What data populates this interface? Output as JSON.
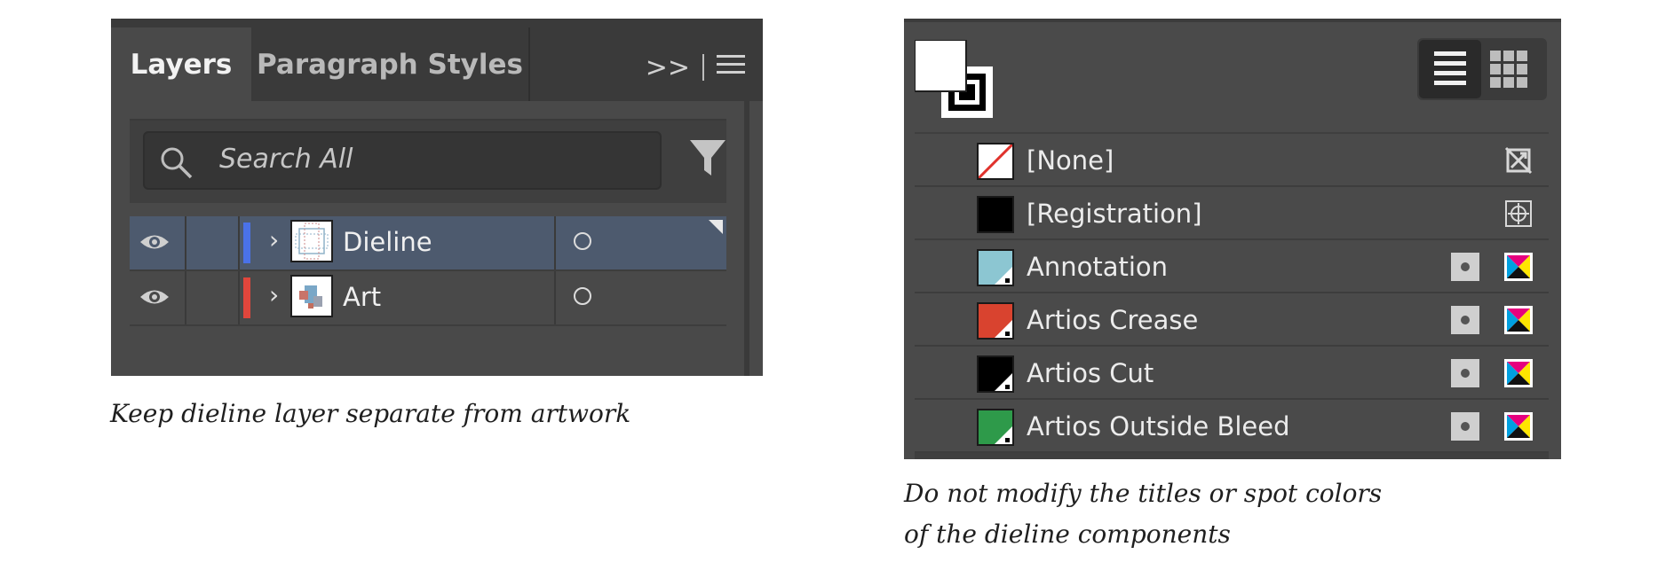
{
  "layers_panel": {
    "tabs": [
      {
        "label": "Layers",
        "active": true
      },
      {
        "label": "Paragraph Styles",
        "active": false
      }
    ],
    "expand_label": ">>",
    "search": {
      "placeholder": "Search All"
    },
    "layers": [
      {
        "name": "Dieline",
        "color": "#4a72e8",
        "selected": true
      },
      {
        "name": "Art",
        "color": "#e0463c",
        "selected": false
      }
    ]
  },
  "caption_left": "Keep dieline layer separate from artwork",
  "swatches_panel": {
    "swatches": [
      {
        "name": "[None]",
        "color": "#ffffff",
        "kind": "none"
      },
      {
        "name": "[Registration]",
        "color": "#000000",
        "kind": "registration"
      },
      {
        "name": "Annotation",
        "color": "#8cc6d2",
        "kind": "spot"
      },
      {
        "name": "Artios Crease",
        "color": "#d9432f",
        "kind": "spot"
      },
      {
        "name": "Artios Cut",
        "color": "#000000",
        "kind": "spot"
      },
      {
        "name": "Artios Outside Bleed",
        "color": "#2e9a4a",
        "kind": "spot"
      }
    ]
  },
  "caption_right": [
    "Do not modify the titles or spot colors",
    "of the dieline components"
  ]
}
